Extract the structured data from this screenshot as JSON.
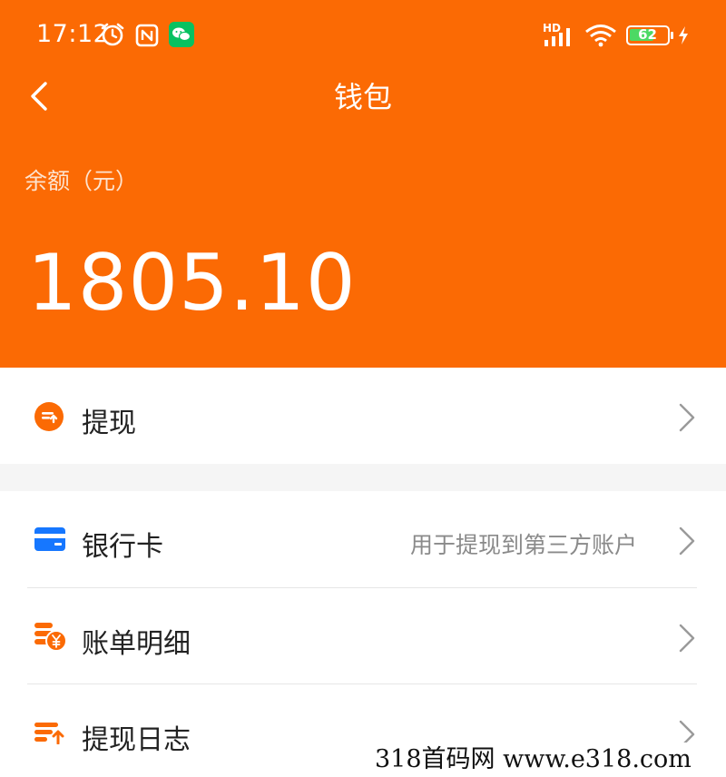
{
  "status_bar": {
    "time": "17:12",
    "battery_level": "62",
    "network_badge": "HD",
    "icons": [
      "alarm-icon",
      "nfc-icon",
      "wechat-icon",
      "signal-icon",
      "wifi-icon",
      "battery-icon",
      "charging-icon"
    ]
  },
  "nav": {
    "title": "钱包",
    "back_icon": "chevron-left-icon"
  },
  "balance": {
    "label": "余额（元）",
    "amount": "1805.10"
  },
  "menu": {
    "withdraw": {
      "label": "提现",
      "icon": "withdraw-icon"
    },
    "bank_card": {
      "label": "银行卡",
      "hint": "用于提现到第三方账户",
      "icon": "bank-card-icon"
    },
    "bill_details": {
      "label": "账单明细",
      "icon": "coins-yen-icon"
    },
    "withdraw_log": {
      "label": "提现日志",
      "icon": "withdraw-log-icon"
    }
  },
  "watermark": {
    "text": "318首码网  www.e318.com"
  },
  "colors": {
    "brand_orange": "#fb6a04",
    "bank_blue": "#1677ff",
    "wechat_green": "#07c160"
  }
}
